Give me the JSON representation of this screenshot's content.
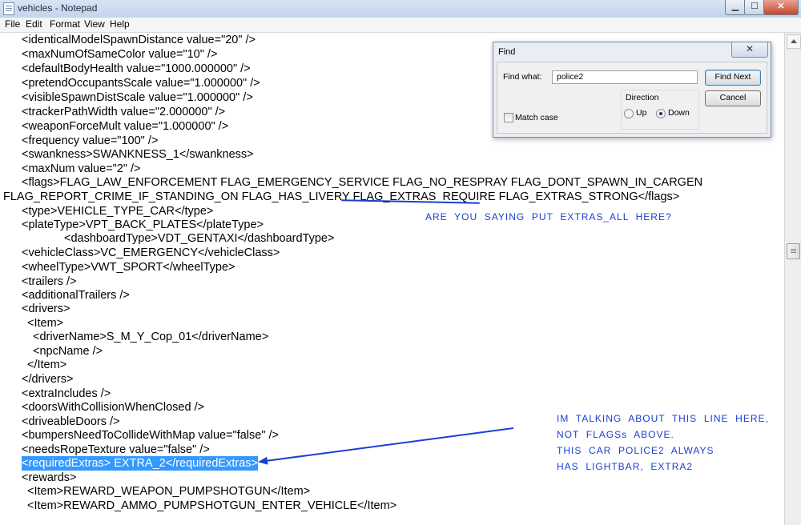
{
  "window": {
    "title": "vehicles - Notepad",
    "min_glyph": "▁",
    "max_glyph": "☐",
    "close_glyph": "✕"
  },
  "menu": [
    "File",
    "Edit",
    "Format",
    "View",
    "Help"
  ],
  "editor_lines": [
    "<identicalModelSpawnDistance value=\"20\" />",
    "<maxNumOfSameColor value=\"10\" />",
    "<defaultBodyHealth value=\"1000.000000\" />",
    "<pretendOccupantsScale value=\"1.000000\" />",
    "<visibleSpawnDistScale value=\"1.000000\" />",
    "<trackerPathWidth value=\"2.000000\" />",
    "<weaponForceMult value=\"1.000000\" />",
    "<frequency value=\"100\" />",
    "<swankness>SWANKNESS_1</swankness>",
    "<maxNum value=\"2\" />",
    "<flags>FLAG_LAW_ENFORCEMENT FLAG_EMERGENCY_SERVICE FLAG_NO_RESPRAY FLAG_DONT_SPAWN_IN_CARGEN",
    "FLAG_REPORT_CRIME_IF_STANDING_ON FLAG_HAS_LIVERY FLAG_EXTRAS_REQUIRE FLAG_EXTRAS_STRONG</flags>",
    "<type>VEHICLE_TYPE_CAR</type>",
    "<plateType>VPT_BACK_PLATES</plateType>",
    "<dashboardType>VDT_GENTAXI</dashboardType>",
    "<vehicleClass>VC_EMERGENCY</vehicleClass>",
    "<wheelType>VWT_SPORT</wheelType>",
    "<trailers />",
    "<additionalTrailers />",
    "<drivers>",
    "<Item>",
    "<driverName>S_M_Y_Cop_01</driverName>",
    "<npcName />",
    "</Item>",
    "</drivers>",
    "<extraIncludes />",
    "<doorsWithCollisionWhenClosed />",
    "<driveableDoors />",
    "<bumpersNeedToCollideWithMap value=\"false\" />",
    "<needsRopeTexture value=\"false\" />",
    "<requiredExtras> EXTRA_2</requiredExtras>",
    "<rewards>",
    "<Item>REWARD_WEAPON_PUMPSHOTGUN</Item>",
    "<Item>REWARD_AMMO_PUMPSHOTGUN_ENTER_VEHICLE</Item>"
  ],
  "find_dialog": {
    "title": "Find",
    "close_glyph": "✕",
    "find_what_label": "Find what:",
    "find_what_value": "police2",
    "find_next_label": "Find Next",
    "cancel_label": "Cancel",
    "direction_label": "Direction",
    "up_label": "Up",
    "down_label": "Down",
    "match_case_label": "Match case",
    "match_case_checked": false,
    "direction_selected": "Down"
  },
  "annotations": {
    "question": "ARE  YOU  SAYING  PUT  EXTRAS_ALL  HERE?",
    "note_lines": [
      "IM  TALKING  ABOUT  THIS  LINE  HERE,",
      "NOT  FLAGSs  ABOVE.",
      "THIS  CAR  POLICE2  ALWAYS",
      "HAS  LIGHTBAR,  EXTRA2"
    ],
    "color": "#1a3fd1"
  },
  "selection_color": "#3399ff"
}
